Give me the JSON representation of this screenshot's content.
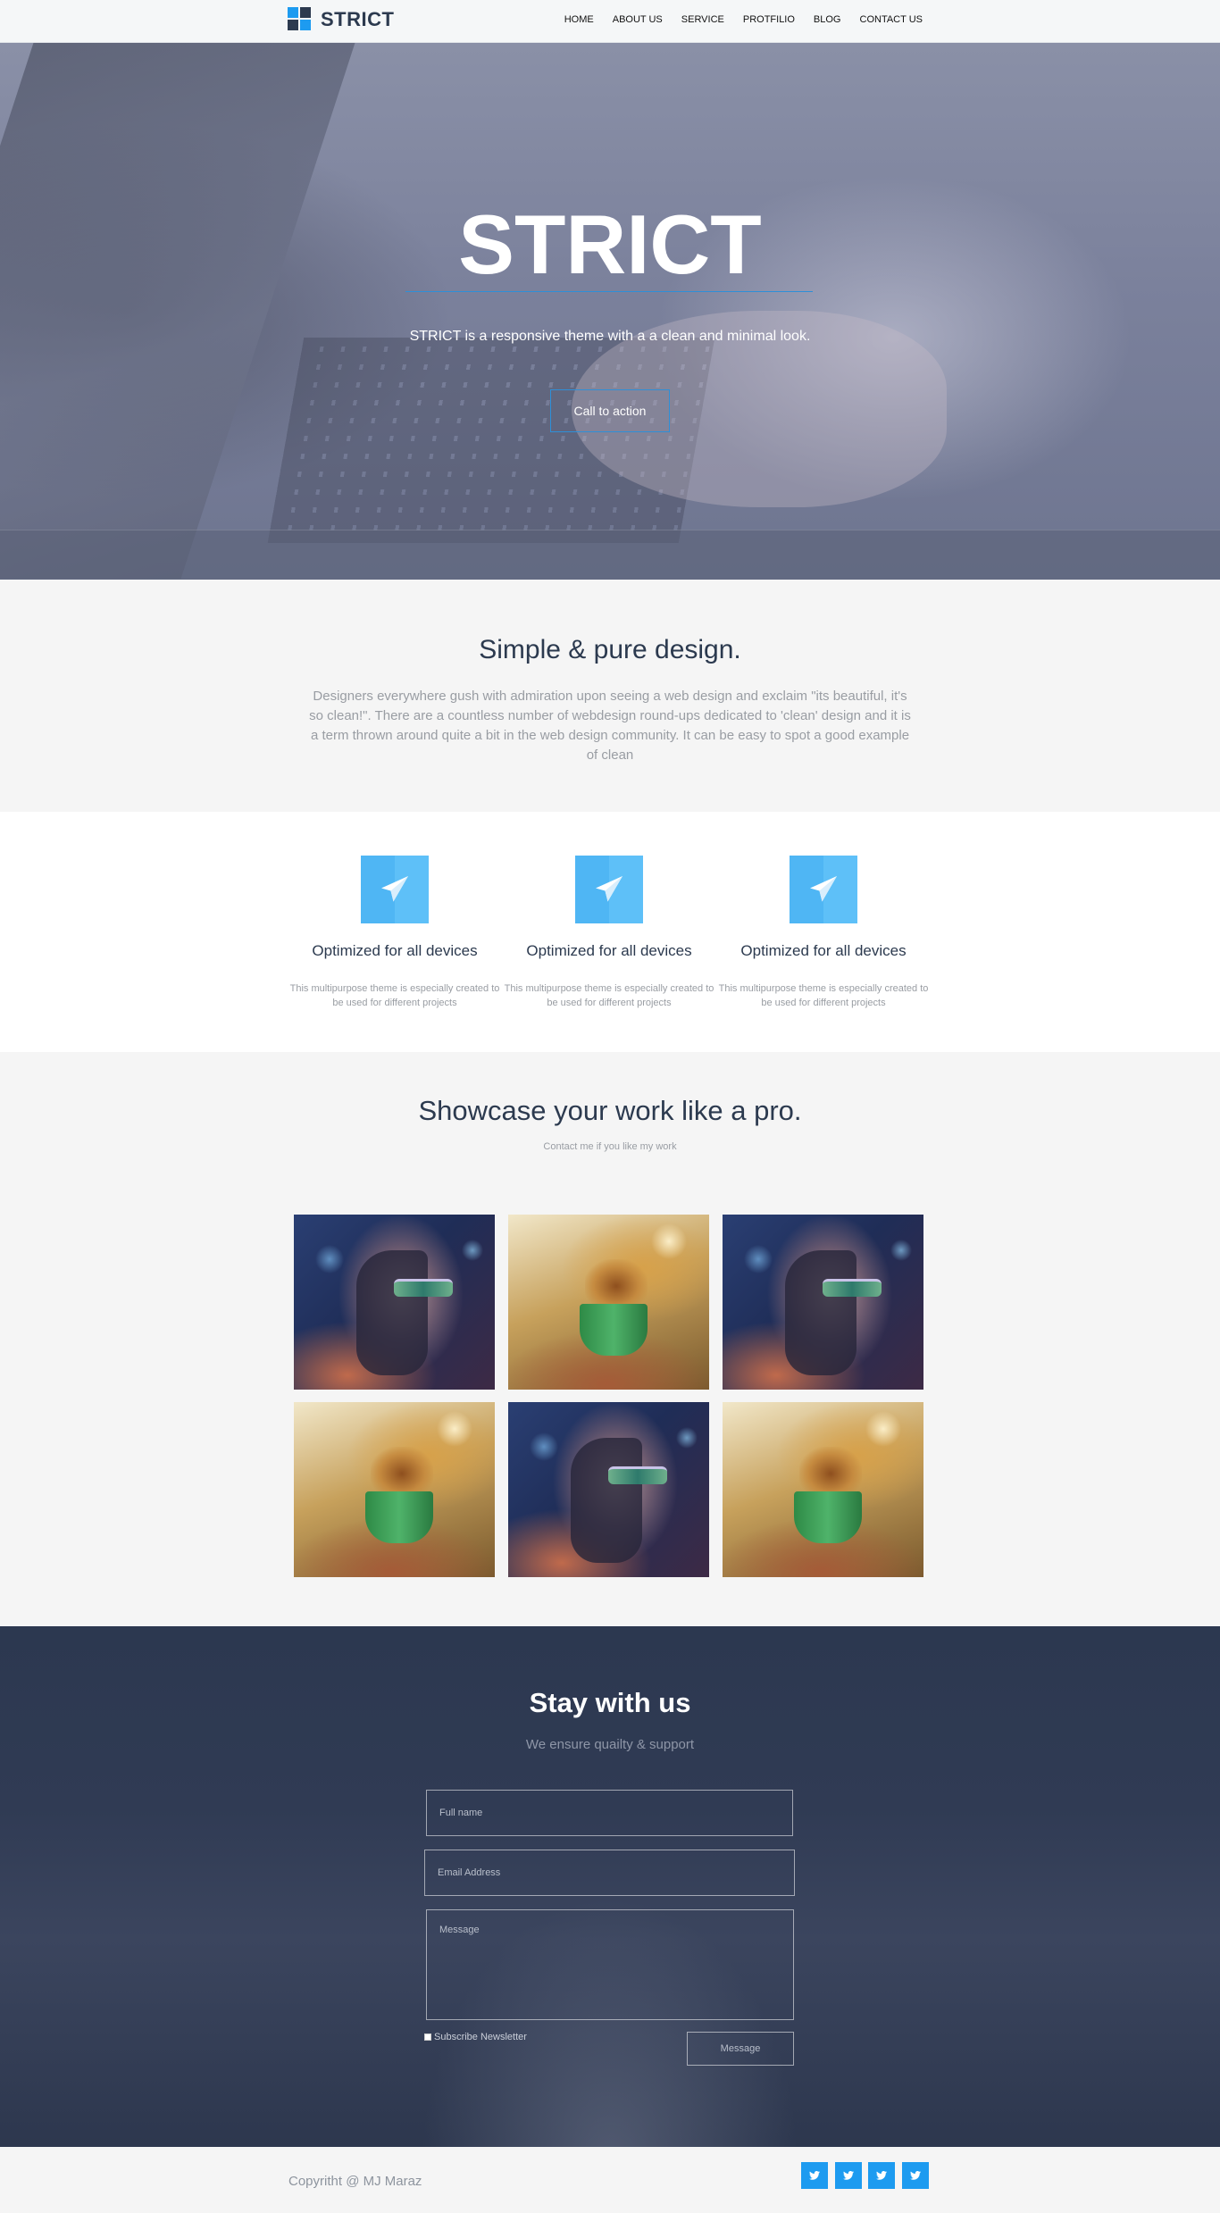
{
  "header": {
    "brand": "STRICT",
    "nav": [
      "HOME",
      "ABOUT US",
      "SERVICE",
      "PROTFILIO",
      "BLOG",
      "CONTACT US"
    ]
  },
  "hero": {
    "title": "STRICT",
    "subtitle": "STRICT is a responsive theme with a a clean and minimal look.",
    "cta": "Call to action"
  },
  "intro": {
    "title": "Simple & pure design.",
    "text": "Designers everywhere gush with admiration upon seeing a web design and exclaim \"its beautiful, it's so clean!\". There are a countless number of webdesign round-ups dedicated to 'clean' design and it is a term thrown around quite a bit in the web design community. It can be easy to spot a good example of clean"
  },
  "features": [
    {
      "icon": "paper-plane-icon",
      "title": "Optimized for all devices",
      "text": "This multipurpose theme is especially created to be used for different projects"
    },
    {
      "icon": "paper-plane-icon",
      "title": "Optimized for all devices",
      "text": "This multipurpose theme is especially created to be used for different projects"
    },
    {
      "icon": "paper-plane-icon",
      "title": "Optimized for all devices",
      "text": "This multipurpose theme is especially created to be used for different projects"
    }
  ],
  "showcase": {
    "title": "Showcase your work like a pro.",
    "subtitle": "Contact me if you like my work",
    "items": [
      "woman-sunglasses",
      "coffee-splash",
      "woman-sunglasses",
      "coffee-splash",
      "woman-sunglasses",
      "coffee-splash"
    ]
  },
  "contact": {
    "title": "Stay with us",
    "subtitle": "We ensure quailty & support",
    "name_placeholder": "Full name",
    "email_placeholder": "Email Address",
    "message_placeholder": "Message",
    "newsletter_label": "Subscribe Newsletter",
    "submit_label": "Message"
  },
  "footer": {
    "copyright": "Copyritht @ MJ Maraz",
    "social": [
      "twitter-icon",
      "twitter-icon",
      "twitter-icon",
      "twitter-icon"
    ]
  },
  "colors": {
    "accent": "#1d9bf0",
    "heading": "#2c3a4f",
    "feature_icon": "#5ec0f8",
    "contact_bg": "#2c3850"
  }
}
